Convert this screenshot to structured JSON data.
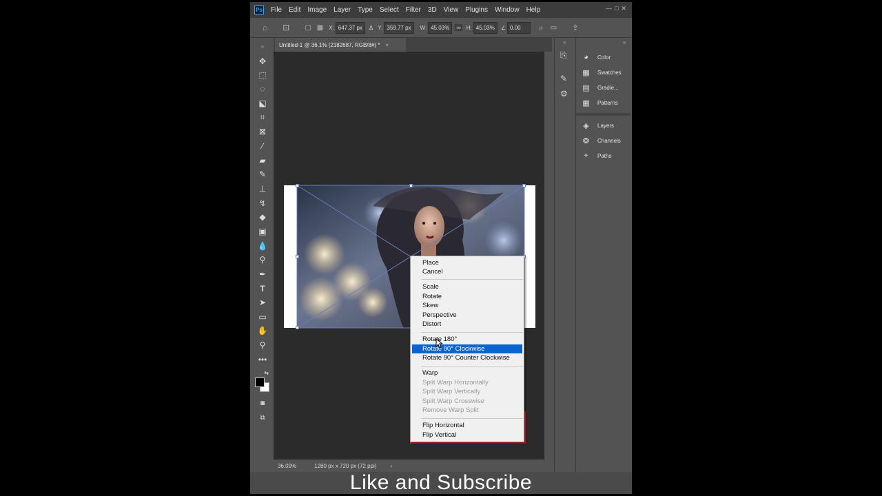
{
  "app": {
    "logo": "Ps",
    "menu": [
      "File",
      "Edit",
      "Image",
      "Layer",
      "Type",
      "Select",
      "Filter",
      "3D",
      "View",
      "Plugins",
      "Window",
      "Help"
    ]
  },
  "options": {
    "x_label": "X:",
    "x_value": "647.37 px",
    "y_label": "Y:",
    "y_value": "359.77 px",
    "w_label": "W:",
    "w_value": "45.03%",
    "h_label": "H:",
    "h_value": "45.03%",
    "angle_value": "0.00"
  },
  "document": {
    "tab_title": "Untitled-1 @ 36.1% (2182687, RGB/8#) *",
    "zoom": "36.09%",
    "doc_size": "1280 px x 720 px (72 ppi)",
    "status_chevron": "›"
  },
  "panels": {
    "group1": [
      "Color",
      "Swatches",
      "Gradie...",
      "Patterns"
    ],
    "group2": [
      "Layers",
      "Channels",
      "Paths"
    ]
  },
  "context_menu": {
    "items": [
      {
        "label": "Place",
        "state": "normal"
      },
      {
        "label": "Cancel",
        "state": "normal"
      },
      {
        "label": "Scale",
        "state": "normal"
      },
      {
        "label": "Rotate",
        "state": "normal"
      },
      {
        "label": "Skew",
        "state": "normal"
      },
      {
        "label": "Perspective",
        "state": "normal"
      },
      {
        "label": "Distort",
        "state": "normal"
      },
      {
        "label": "Rotate 180°",
        "state": "normal"
      },
      {
        "label": "Rotate 90° Clockwise",
        "state": "selected"
      },
      {
        "label": "Rotate 90° Counter Clockwise",
        "state": "normal"
      },
      {
        "label": "Warp",
        "state": "normal"
      },
      {
        "label": "Split Warp Horizontally",
        "state": "disabled"
      },
      {
        "label": "Split Warp Vertically",
        "state": "disabled"
      },
      {
        "label": "Split Warp Crosswise",
        "state": "disabled"
      },
      {
        "label": "Remove Warp Split",
        "state": "disabled"
      },
      {
        "label": "Flip Horizontal",
        "state": "normal"
      },
      {
        "label": "Flip Vertical",
        "state": "normal"
      }
    ]
  },
  "caption": "Like and Subscribe",
  "colors": {
    "accent": "#0a64d0",
    "highlight": "#d21a1a"
  }
}
